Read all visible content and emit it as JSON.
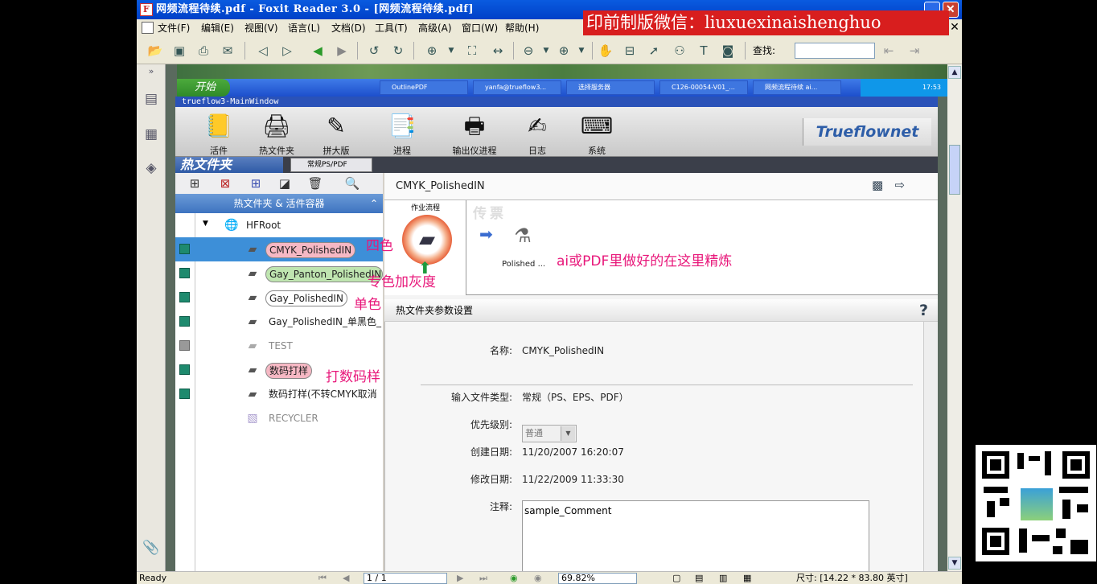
{
  "window": {
    "title": "网频流程待续.pdf - Foxit Reader 3.0 - [网频流程待续.pdf]",
    "close": "✕",
    "minimize": "_"
  },
  "watermark": "印前制版微信：liuxuexinaishenghuo",
  "menu": [
    "文件(F)",
    "编辑(E)",
    "视图(V)",
    "语言(L)",
    "文档(D)",
    "工具(T)",
    "高级(A)",
    "窗口(W)",
    "帮助(H)"
  ],
  "mdi_close": "✕",
  "toolbar": {
    "find_label": "查找:",
    "find_value": ""
  },
  "desktop": {
    "start": "开始",
    "tasks": [
      "OutlinePDF",
      "yanfa@trueflow3...",
      "选择服务器",
      "C126-00054-V01_...",
      "网频流程待续 ai..."
    ],
    "clock": "17:53"
  },
  "trueflow": {
    "window_title": "trueflow3-MainWindow",
    "toolbar": [
      {
        "label": "活件",
        "icon": "job-icon"
      },
      {
        "label": "热文件夹",
        "icon": "hotfolder-icon"
      },
      {
        "label": "拼大版",
        "icon": "imposition-icon"
      },
      {
        "label": "进程",
        "icon": "process-icon"
      },
      {
        "label": "输出仪进程",
        "icon": "output-device-icon"
      },
      {
        "label": "日志",
        "icon": "log-icon"
      },
      {
        "label": "系统",
        "icon": "system-icon"
      }
    ],
    "logo": "Trueflownet",
    "left_title": "热文件夹",
    "left_dropdown": "常规PS/PDF",
    "container_header": "热文件夹 & 活件容器",
    "tree": [
      {
        "label": "HFRoot",
        "status": "none",
        "style": "root"
      },
      {
        "label": "CMYK_PolishedIN",
        "status": "active",
        "style": "selected"
      },
      {
        "label": "Gay_Panton_PolishedIN",
        "status": "active",
        "style": "green"
      },
      {
        "label": "Gay_PolishedIN",
        "status": "active",
        "style": "plain-pill"
      },
      {
        "label": "Gay_PolishedIN_单黑色_",
        "status": "active",
        "style": "plain"
      },
      {
        "label": "TEST",
        "status": "inactive",
        "style": "disabled"
      },
      {
        "label": "数码打样",
        "status": "active",
        "style": "pink"
      },
      {
        "label": "数码打样(不转CMYK取消",
        "status": "active",
        "style": "plain"
      },
      {
        "label": "RECYCLER",
        "status": "none",
        "style": "disabled"
      }
    ],
    "right_title": "CMYK_PolishedIN",
    "flow_card_label": "作业流程",
    "flow_banner": "传票",
    "flow_node_label": "Polished ...",
    "params_title": "热文件夹参数设置",
    "help": "?",
    "params": {
      "name_label": "名称:",
      "name_value": "CMYK_PolishedIN",
      "type_label": "输入文件类型:",
      "type_value": "常规（PS、EPS、PDF）",
      "priority_label": "优先级别:",
      "priority_value": "普通",
      "created_label": "创建日期:",
      "created_value": "11/20/2007 16:20:07",
      "modified_label": "修改日期:",
      "modified_value": "11/22/2009 11:33:30",
      "comment_label": "注释:",
      "comment_value": "sample_Comment"
    }
  },
  "annotations": {
    "four_color": "四色",
    "spot_gray": "专色加灰度",
    "mono": "单色",
    "proof": "打数码样",
    "polish_note": "ai或PDF里做好的在这里精炼"
  },
  "statusbar": {
    "ready": "Ready",
    "page": "1 / 1",
    "zoom": "69.82%",
    "size": "尺寸: [14.22 * 83.80 英寸]"
  },
  "colors": {
    "annotation": "#e8177a",
    "watermark_bg": "#d81e1e",
    "title_bar": "#0a5be0"
  }
}
